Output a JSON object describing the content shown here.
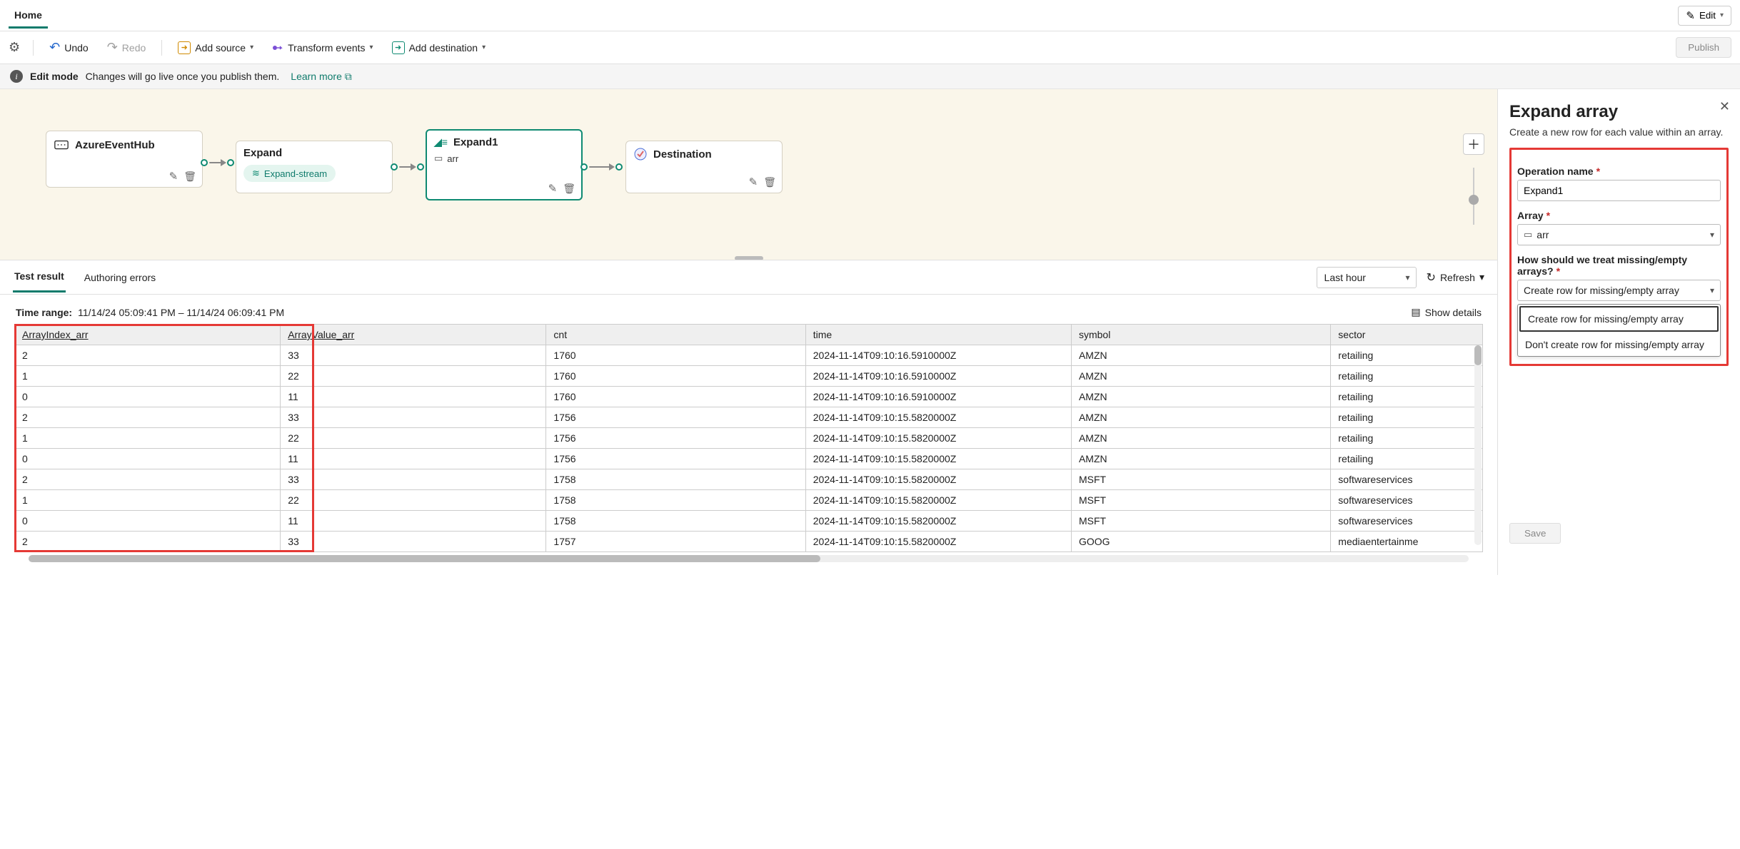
{
  "tabs": {
    "home": "Home"
  },
  "editButton": "Edit",
  "commandBar": {
    "undo": "Undo",
    "redo": "Redo",
    "addSource": "Add source",
    "transformEvents": "Transform events",
    "addDestination": "Add destination",
    "publish": "Publish"
  },
  "infoBar": {
    "title": "Edit mode",
    "text": "Changes will go live once you publish them.",
    "link": "Learn more"
  },
  "canvas": {
    "nodes": {
      "source": {
        "title": "AzureEventHub"
      },
      "expand": {
        "title": "Expand",
        "chip": "Expand-stream"
      },
      "expand1": {
        "title": "Expand1",
        "sub": "arr"
      },
      "dest": {
        "title": "Destination"
      }
    }
  },
  "resultsTabs": {
    "testResult": "Test result",
    "authoringErrors": "Authoring errors",
    "lastHour": "Last hour",
    "refresh": "Refresh"
  },
  "timeRange": {
    "label": "Time range:",
    "value": "11/14/24 05:09:41 PM – 11/14/24 06:09:41 PM",
    "showDetails": "Show details"
  },
  "table": {
    "columns": [
      "ArrayIndex_arr",
      "ArrayValue_arr",
      "cnt",
      "time",
      "symbol",
      "sector"
    ],
    "rows": [
      [
        "2",
        "33",
        "1760",
        "2024-11-14T09:10:16.5910000Z",
        "AMZN",
        "retailing"
      ],
      [
        "1",
        "22",
        "1760",
        "2024-11-14T09:10:16.5910000Z",
        "AMZN",
        "retailing"
      ],
      [
        "0",
        "11",
        "1760",
        "2024-11-14T09:10:16.5910000Z",
        "AMZN",
        "retailing"
      ],
      [
        "2",
        "33",
        "1756",
        "2024-11-14T09:10:15.5820000Z",
        "AMZN",
        "retailing"
      ],
      [
        "1",
        "22",
        "1756",
        "2024-11-14T09:10:15.5820000Z",
        "AMZN",
        "retailing"
      ],
      [
        "0",
        "11",
        "1756",
        "2024-11-14T09:10:15.5820000Z",
        "AMZN",
        "retailing"
      ],
      [
        "2",
        "33",
        "1758",
        "2024-11-14T09:10:15.5820000Z",
        "MSFT",
        "softwareservices"
      ],
      [
        "1",
        "22",
        "1758",
        "2024-11-14T09:10:15.5820000Z",
        "MSFT",
        "softwareservices"
      ],
      [
        "0",
        "11",
        "1758",
        "2024-11-14T09:10:15.5820000Z",
        "MSFT",
        "softwareservices"
      ],
      [
        "2",
        "33",
        "1757",
        "2024-11-14T09:10:15.5820000Z",
        "GOOG",
        "mediaentertainme"
      ]
    ]
  },
  "panel": {
    "title": "Expand array",
    "subtitle": "Create a new row for each value within an array.",
    "opNameLabel": "Operation name",
    "opNameValue": "Expand1",
    "arrayLabel": "Array",
    "arrayValue": "arr",
    "missingLabel": "How should we treat missing/empty arrays?",
    "missingValue": "Create row for missing/empty array",
    "options": [
      "Create row for missing/empty array",
      "Don't create row for missing/empty array"
    ],
    "save": "Save"
  }
}
